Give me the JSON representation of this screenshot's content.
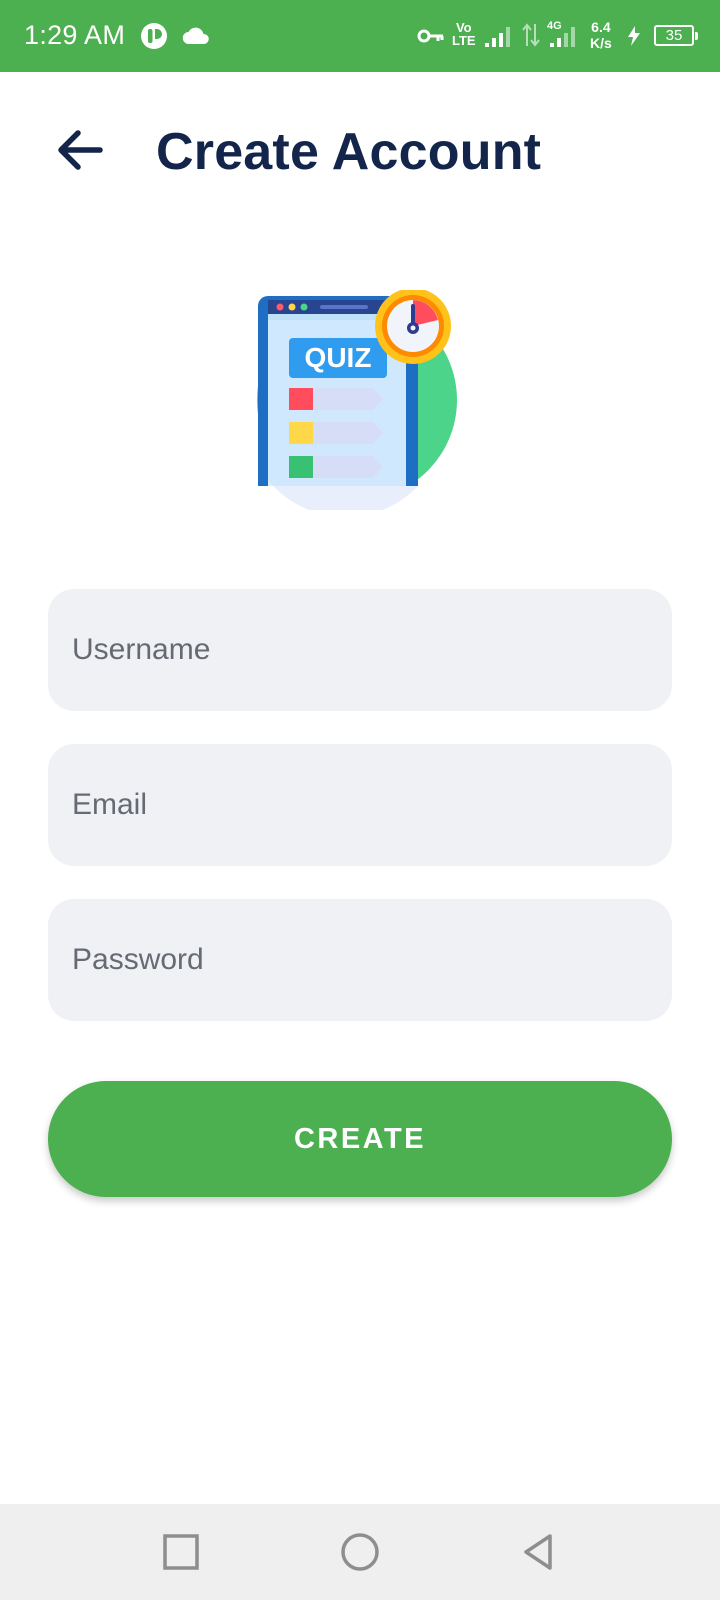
{
  "status_bar": {
    "time": "1:29 AM",
    "volte_top": "Vo",
    "volte_bottom": "LTE",
    "network_type": "4G",
    "speed_value": "6.4",
    "speed_unit": "K/s",
    "battery": "35",
    "background_color": "#4caf50"
  },
  "header": {
    "title": "Create Account",
    "back_icon": "arrow-left-icon"
  },
  "illustration": {
    "label": "QUIZ"
  },
  "form": {
    "username_placeholder": "Username",
    "email_placeholder": "Email",
    "password_placeholder": "Password",
    "create_label": "CREATE",
    "accent_color": "#4caf50"
  },
  "nav_bar": {
    "recents_icon": "square-icon",
    "home_icon": "circle-icon",
    "back_icon": "triangle-back-icon"
  }
}
